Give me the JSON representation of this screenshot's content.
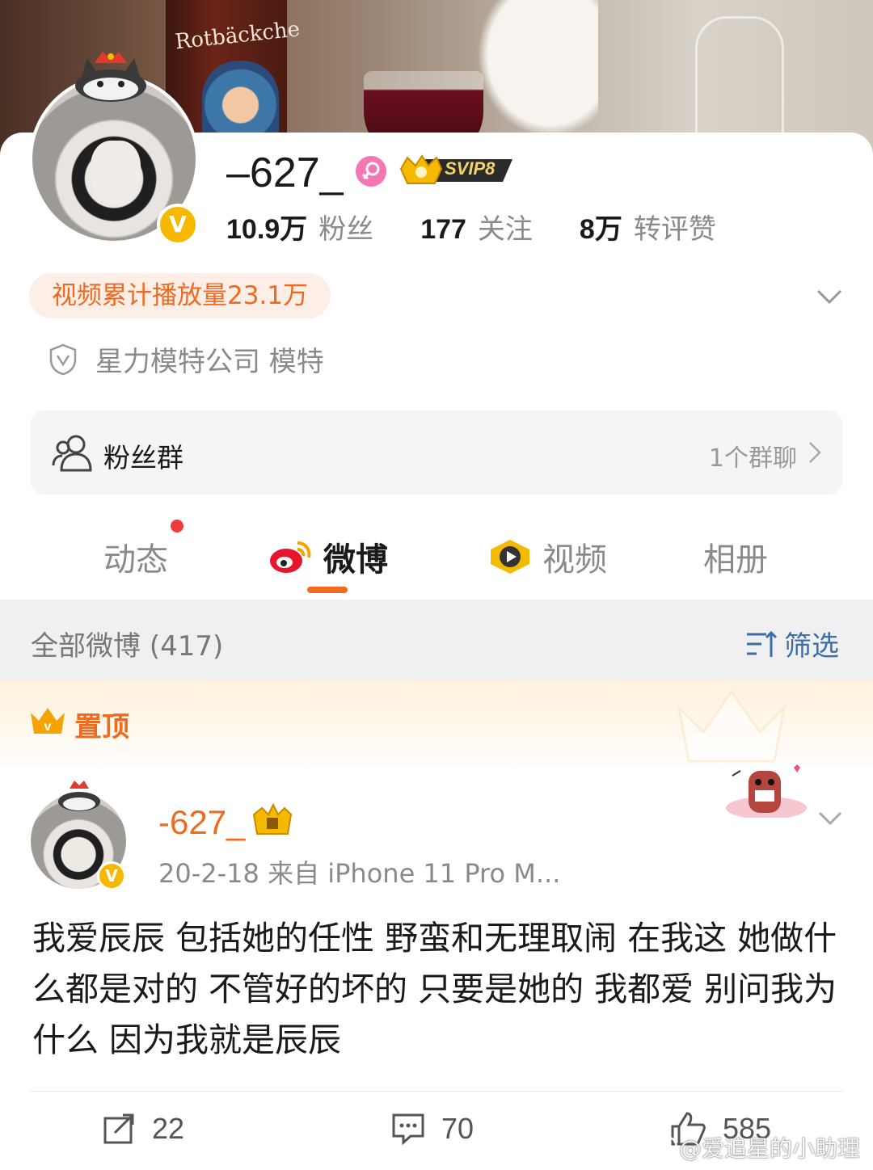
{
  "banner": {
    "bottle_text": "Rotbäckche"
  },
  "profile": {
    "username": "–627_",
    "svip_label": "SVIP8",
    "verified_mark": "V",
    "stats": [
      {
        "value": "10.9万",
        "label": "粉丝"
      },
      {
        "value": "177",
        "label": "关注"
      },
      {
        "value": "8万",
        "label": "转评赞"
      }
    ],
    "video_pill": "视频累计播放量23.1万",
    "org": "星力模特公司 模特"
  },
  "fans_group": {
    "label": "粉丝群",
    "count": "1个群聊"
  },
  "tabs": [
    {
      "label": "动态",
      "active": false,
      "has_dot": true
    },
    {
      "label": "微博",
      "active": true
    },
    {
      "label": "视频",
      "active": false
    },
    {
      "label": "相册",
      "active": false
    }
  ],
  "feed": {
    "all_label": "全部微博 (417)",
    "filter_label": "筛选",
    "pinned_label": "置顶"
  },
  "post": {
    "username": "-627_",
    "verified_mark": "V",
    "meta": "20-2-18  来自 iPhone 11 Pro M...",
    "text": "我爱辰辰 包括她的任性 野蛮和无理取闹 在我这 她做什么都是对的 不管好的坏的 只要是她的 我都爱 别问我为什么 因为我就是辰辰",
    "reposts": "22",
    "comments": "70",
    "likes": "585"
  },
  "watermark": "@爱追星的小助理",
  "colors": {
    "accent_orange": "#ee6a1e",
    "link_blue": "#3b6ea8",
    "verified_gold": "#f5b900",
    "female_pink": "#f477b3"
  }
}
